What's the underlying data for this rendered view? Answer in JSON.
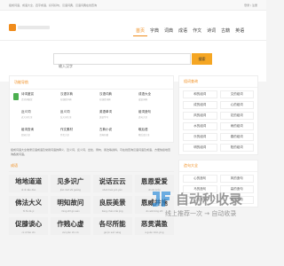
{
  "topbar": {
    "left_text": "组成词语、成语大全、四字成语、好词好句、汉语词典、汉语词典在线查询",
    "right_text": "登录 / 注册"
  },
  "nav": {
    "items": [
      {
        "label": "首页",
        "active": true
      },
      {
        "label": "字典",
        "active": false
      },
      {
        "label": "词典",
        "active": false
      },
      {
        "label": "成语",
        "active": false
      },
      {
        "label": "作文",
        "active": false
      },
      {
        "label": "诗词",
        "active": false
      },
      {
        "label": "古籍",
        "active": false
      },
      {
        "label": "英语",
        "active": false
      }
    ]
  },
  "search": {
    "placeholder": "输入汉字",
    "button_label": "搜索"
  },
  "tools_panel": {
    "title": "功能导航",
    "items": [
      {
        "name": "诗词鉴赏",
        "desc": "古诗词鉴赏"
      },
      {
        "name": "汉语字典",
        "desc": "在线查字典"
      },
      {
        "name": "汉语词典",
        "desc": "在线查词典"
      },
      {
        "name": "成语大全",
        "desc": "成语词典"
      },
      {
        "name": "近义词",
        "desc": "近义词大全"
      },
      {
        "name": "反义词",
        "desc": "反义词大全"
      },
      {
        "name": "英语单词",
        "desc": "英语学习"
      },
      {
        "name": "组词造句",
        "desc": "造句大全"
      },
      {
        "name": "组词查询",
        "desc": "组词大全"
      },
      {
        "name": "作文素材",
        "desc": "作文大全"
      },
      {
        "name": "古典小说",
        "desc": "古典名著"
      },
      {
        "name": "歇后语",
        "desc": "歇后语大全"
      }
    ]
  },
  "intro": "组成词语大全收录汉语成语及常用词语的释义、近义词、反义词、出处、例句、用法等资料，可在线查询汉语词语及成语，方便快捷地查询各类词语。",
  "idioms": {
    "title": "成语",
    "items": [
      {
        "name": "地地道道",
        "pinyin": "dì dì dào dào"
      },
      {
        "name": "见多识广",
        "pinyin": "jiàn duō shí guǎng"
      },
      {
        "name": "说话云云",
        "pinyin": "shuō huà yún yún"
      },
      {
        "name": "恩恩爱爱",
        "pinyin": "ēn ēn ài ài"
      },
      {
        "name": "佛法大义",
        "pinyin": "fó fǎ dà yì"
      },
      {
        "name": "明知故问",
        "pinyin": "míng zhī gù wèn"
      },
      {
        "name": "良辰美景",
        "pinyin": "liáng chén měi jǐng"
      },
      {
        "name": "恩威并施",
        "pinyin": "ēn wēi bìng shī"
      },
      {
        "name": "促膝谈心",
        "pinyin": "cù xī tán xīn"
      },
      {
        "name": "作贱心虚",
        "pinyin": "zuò jiàn xīn xū"
      },
      {
        "name": "各尽所能",
        "pinyin": "gè jìn suǒ néng"
      },
      {
        "name": "恶贯满盈",
        "pinyin": "è guàn mǎn yíng"
      }
    ]
  },
  "side_panels": [
    {
      "title": "组词查询",
      "items": [
        "和的组词",
        "文的组词",
        "成的组词",
        "心的组词",
        "风的组词",
        "花的组词",
        "水的组词",
        "雨的组词",
        "乐的组词",
        "春的组词",
        "明的组词",
        "阳的组词"
      ]
    },
    {
      "title": "造句大全",
      "items": [
        "心的造句",
        "风的造句",
        "马的造句",
        "高的造句",
        "山的造句",
        "美的造句"
      ]
    }
  ],
  "watermark": {
    "text": "自动秒收录",
    "sub": "线上推荐一次 → 自动收录"
  },
  "colors": {
    "accent": "#f08c1c",
    "button": "#f5a623",
    "brand_blue": "#2a8bd8"
  }
}
